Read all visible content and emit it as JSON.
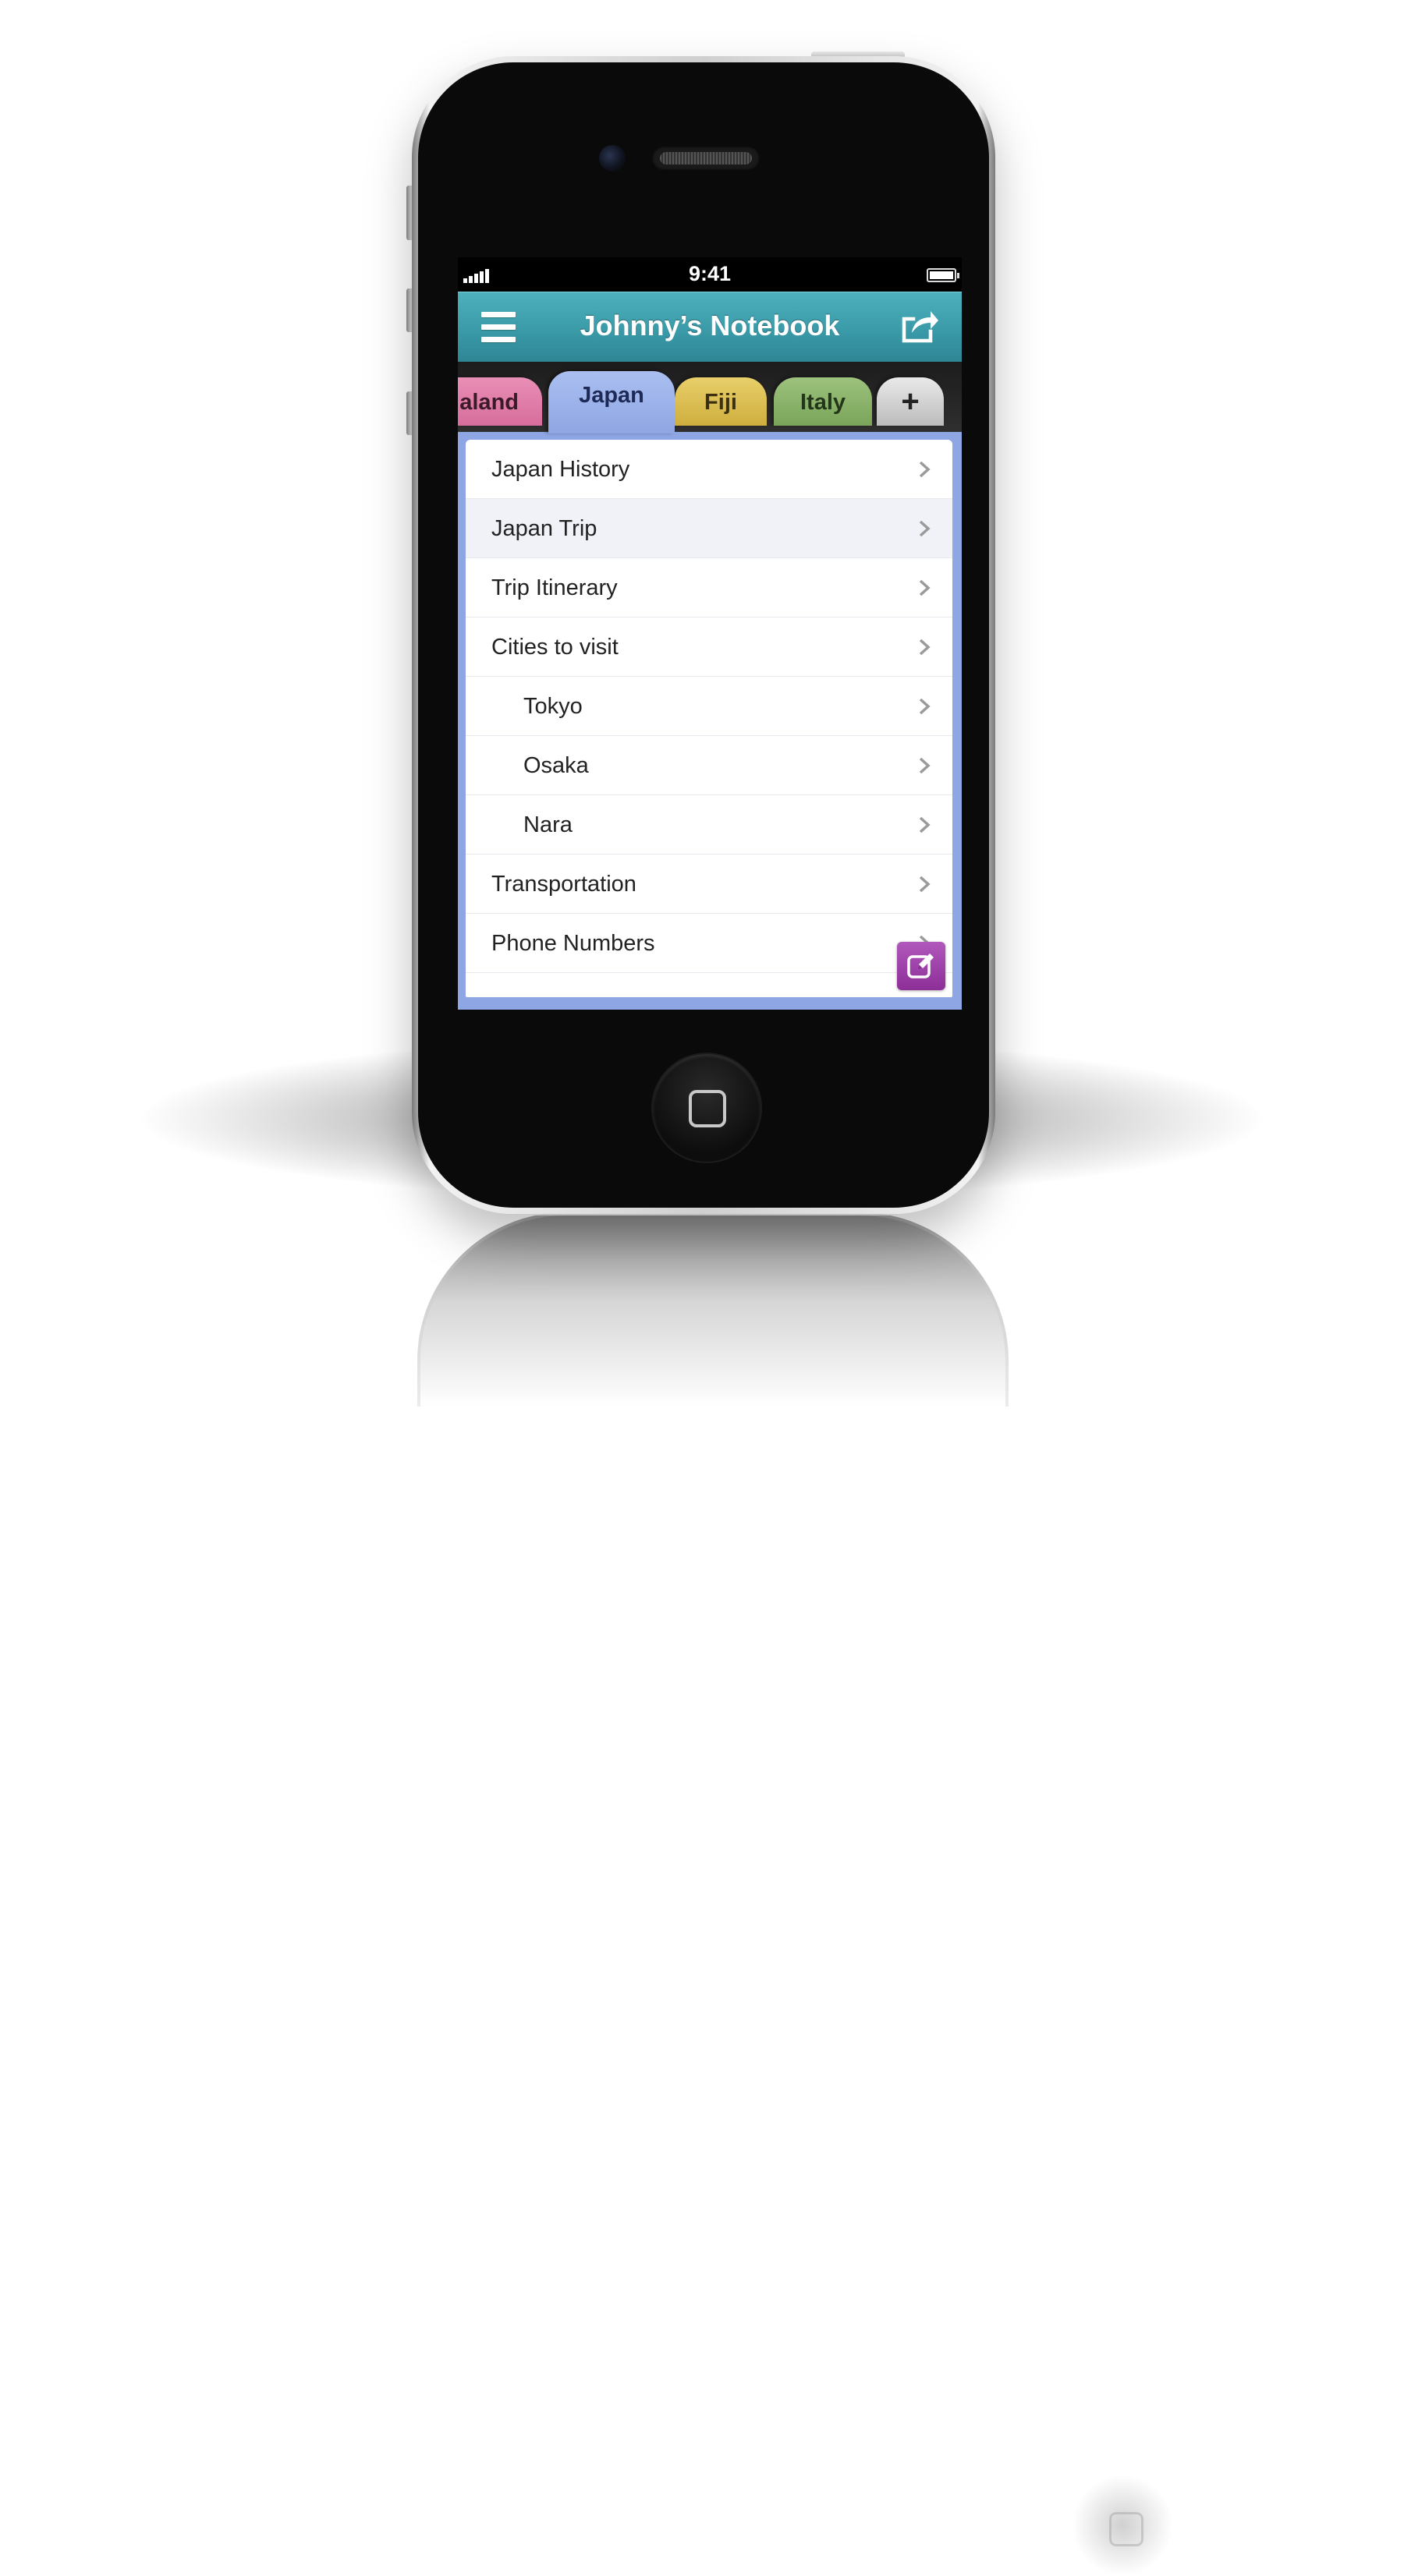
{
  "status_bar": {
    "time": "9:41",
    "signal_icon": "signal-bars-icon",
    "battery_icon": "battery-icon"
  },
  "nav": {
    "title": "Johnny’s Notebook",
    "menu_icon": "hamburger-menu-icon",
    "share_icon": "share-icon"
  },
  "tabs": [
    {
      "label": "aland",
      "color": "#e07fac"
    },
    {
      "label": "Japan",
      "color": "#9fb5ec",
      "active": true
    },
    {
      "label": "Fiji",
      "color": "#ddbf52"
    },
    {
      "label": "Italy",
      "color": "#8bb56b"
    },
    {
      "label": "+",
      "color": "#d6d6d6"
    }
  ],
  "list": {
    "items": [
      {
        "label": "Japan History"
      },
      {
        "label": "Japan Trip"
      },
      {
        "label": "Trip Itinerary"
      },
      {
        "label": "Cities to visit"
      },
      {
        "label": "Tokyo"
      },
      {
        "label": "Osaka"
      },
      {
        "label": "Nara"
      },
      {
        "label": "Transportation"
      },
      {
        "label": "Phone Numbers"
      }
    ]
  },
  "compose_icon": "compose-edit-icon",
  "colors": {
    "nav_bar": "#3a9aa8",
    "active_tab_panel": "#8fa6e4",
    "compose_button": "#9e40a9"
  }
}
